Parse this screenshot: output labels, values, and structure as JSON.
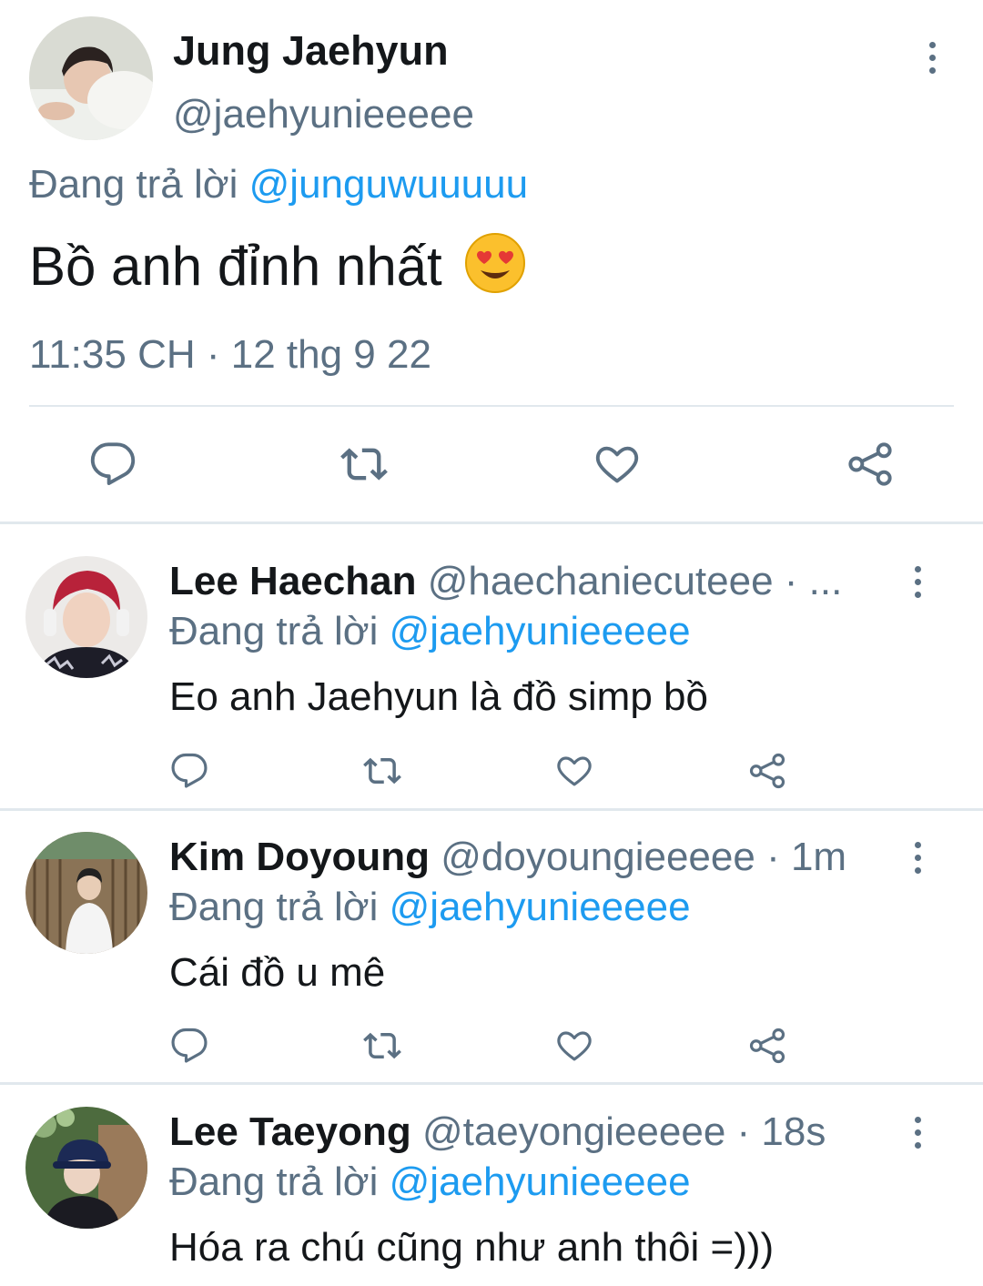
{
  "main_tweet": {
    "display_name": "Jung Jaehyun",
    "handle": "@jaehyunieeeee",
    "reply_prefix": "Đang trả lời",
    "reply_to": "@junguwuuuuu",
    "text": "Bồ anh đỉnh nhất",
    "emoji": "😍",
    "timestamp": "11:35 CH · 12 thg 9 22"
  },
  "replies": [
    {
      "display_name": "Lee Haechan",
      "handle_meta": "@haechaniecuteee · ...",
      "reply_prefix": "Đang trả lời",
      "reply_to": "@jaehyunieeeee",
      "text": "Eo anh Jaehyun là đồ simp bồ"
    },
    {
      "display_name": "Kim Doyoung",
      "handle_meta": "@doyoungieeeee · 1m",
      "reply_prefix": "Đang trả lời",
      "reply_to": "@jaehyunieeeee",
      "text": "Cái đồ u mê"
    },
    {
      "display_name": "Lee Taeyong",
      "handle_meta": "@taeyongieeeee · 18s",
      "reply_prefix": "Đang trả lời",
      "reply_to": "@jaehyunieeeee",
      "text": "Hóa ra chú cũng như anh thôi =)))"
    }
  ],
  "icons": {
    "reply": "reply-icon",
    "retweet": "retweet-icon",
    "like": "like-icon",
    "share": "share-icon",
    "more": "more-options-icon"
  },
  "colors": {
    "link_blue": "#1d9bf0",
    "secondary_gray": "#5b7083",
    "divider": "#e1e8ed"
  }
}
